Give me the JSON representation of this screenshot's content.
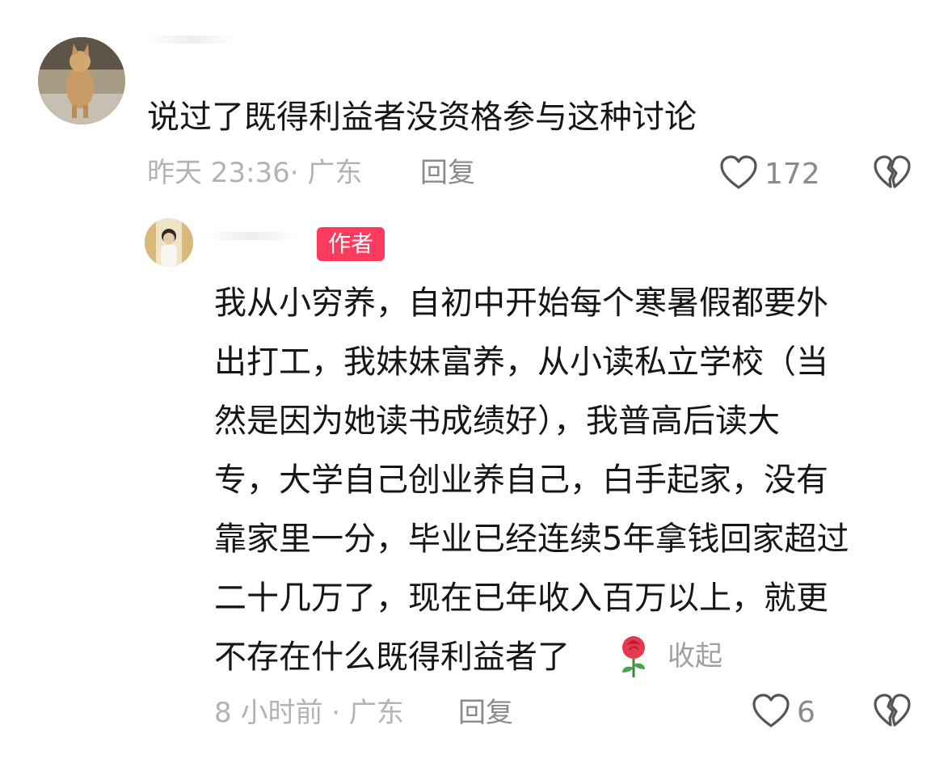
{
  "comment": {
    "text": "说过了既得利益者没资格参与这种讨论",
    "time_location": "昨天 23:36· 广东",
    "reply_label": "回复",
    "likes": "172"
  },
  "reply": {
    "author_badge": "作者",
    "lines": [
      "我从小穷养，自初中开始每个寒暑假都要外",
      "出打工，我妹妹富养，从小读私立学校（当",
      "然是因为她读书成绩好），我普高后读大",
      "专，大学自己创业养自己，白手起家，没有",
      "靠家里一分，毕业已经连续5年拿钱回家超过",
      "二十几万了，现在已年收入百万以上，就更",
      "不存在什么既得利益者了"
    ],
    "emoji": "🌹",
    "collapse_label": "收起",
    "time_location": "8 小时前 · 广东",
    "reply_label": "回复",
    "likes": "6"
  },
  "icons": {
    "like": "heart-outline-icon",
    "dislike": "broken-heart-icon",
    "emoji": "rose-emoji"
  },
  "colors": {
    "badge": "#fb3b5d",
    "meta": "#b3b3b3",
    "text": "#161616"
  }
}
